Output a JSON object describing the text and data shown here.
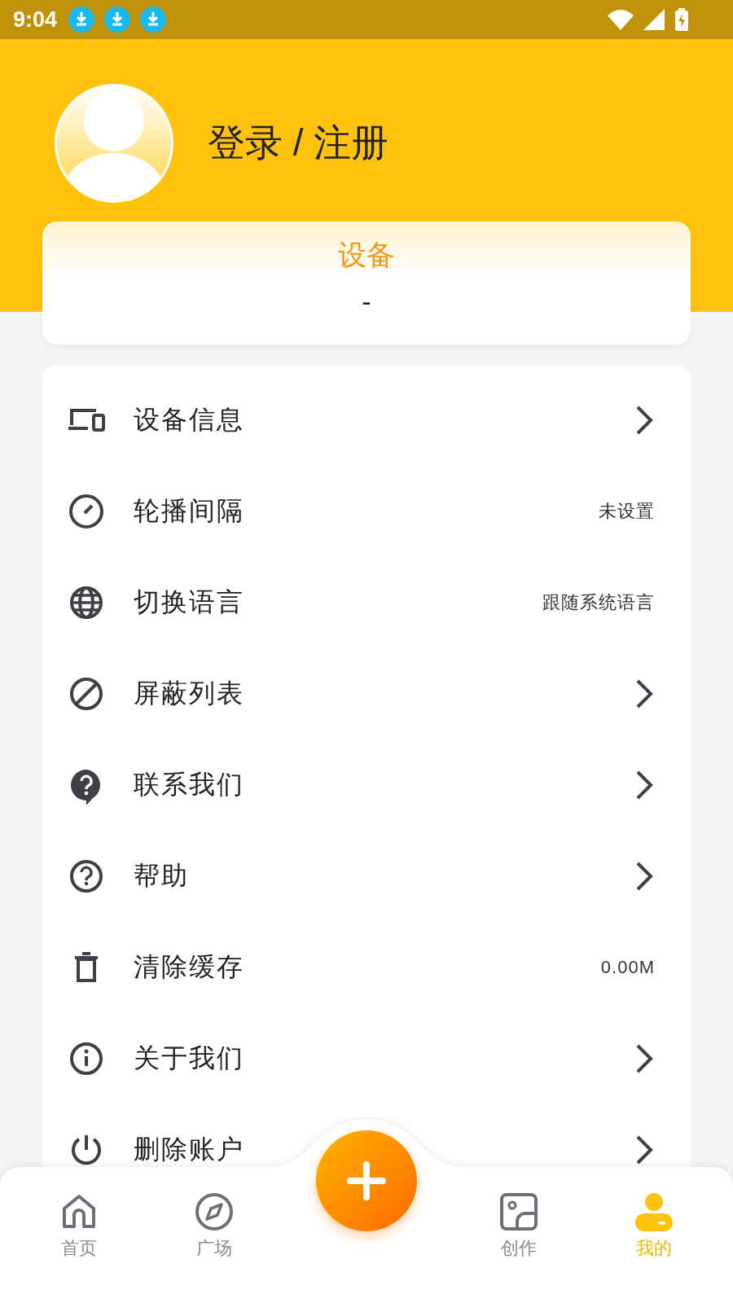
{
  "status_bar": {
    "time": "9:04"
  },
  "profile": {
    "login_label": "登录 / 注册"
  },
  "device_card": {
    "title": "设备",
    "value": "-"
  },
  "menu": [
    {
      "label": "设备信息",
      "kind": "chevron"
    },
    {
      "label": "轮播间隔",
      "kind": "value",
      "value": "未设置"
    },
    {
      "label": "切换语言",
      "kind": "value",
      "value": "跟随系统语言"
    },
    {
      "label": "屏蔽列表",
      "kind": "chevron"
    },
    {
      "label": "联系我们",
      "kind": "chevron"
    },
    {
      "label": "帮助",
      "kind": "chevron"
    },
    {
      "label": "清除缓存",
      "kind": "value",
      "value": "0.00M"
    },
    {
      "label": "关于我们",
      "kind": "chevron"
    },
    {
      "label": "删除账户",
      "kind": "chevron"
    }
  ],
  "bottom_nav": {
    "items": [
      {
        "label": "首页",
        "selected": false
      },
      {
        "label": "广场",
        "selected": false
      },
      {
        "label": "创作",
        "selected": false
      },
      {
        "label": "我的",
        "selected": true
      }
    ]
  }
}
